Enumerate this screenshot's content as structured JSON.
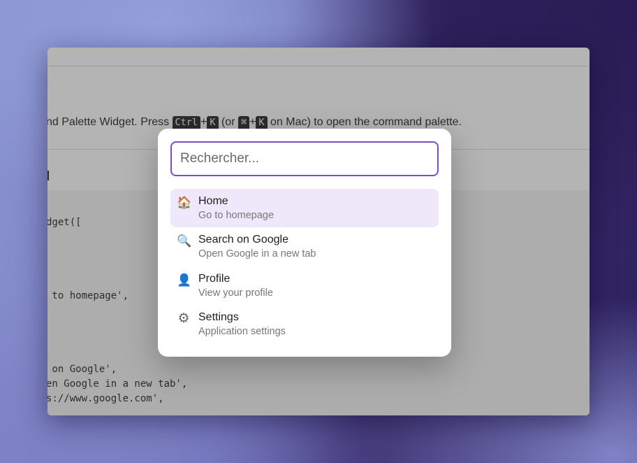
{
  "window": {
    "intro_prefix": "nd Palette Widget. Press ",
    "kbd_ctrl": "Ctrl",
    "plus": "+",
    "kbd_k": "K",
    "mid_text": " (or ",
    "kbd_cmd": "⌘",
    "suffix_text": " on Mac) to open the command palette.",
    "code_lines": [
      "dget([",
      " to homepage',",
      " on Google',",
      "en Google in a new tab',",
      "s://www.google.com',"
    ]
  },
  "palette": {
    "search_placeholder": "Rechercher...",
    "items": [
      {
        "icon": "house-icon",
        "glyph": "🏠",
        "title": "Home",
        "description": "Go to homepage",
        "selected": true
      },
      {
        "icon": "search-icon",
        "glyph": "🔍",
        "title": "Search on Google",
        "description": "Open Google in a new tab",
        "selected": false
      },
      {
        "icon": "user-icon",
        "glyph": "👤",
        "title": "Profile",
        "description": "View your profile",
        "selected": false
      },
      {
        "icon": "gear-icon",
        "glyph": "⚙",
        "title": "Settings",
        "description": "Application settings",
        "selected": false
      }
    ]
  },
  "colors": {
    "accent": "#7e4cc9",
    "selected_bg": "#efe8fb"
  }
}
